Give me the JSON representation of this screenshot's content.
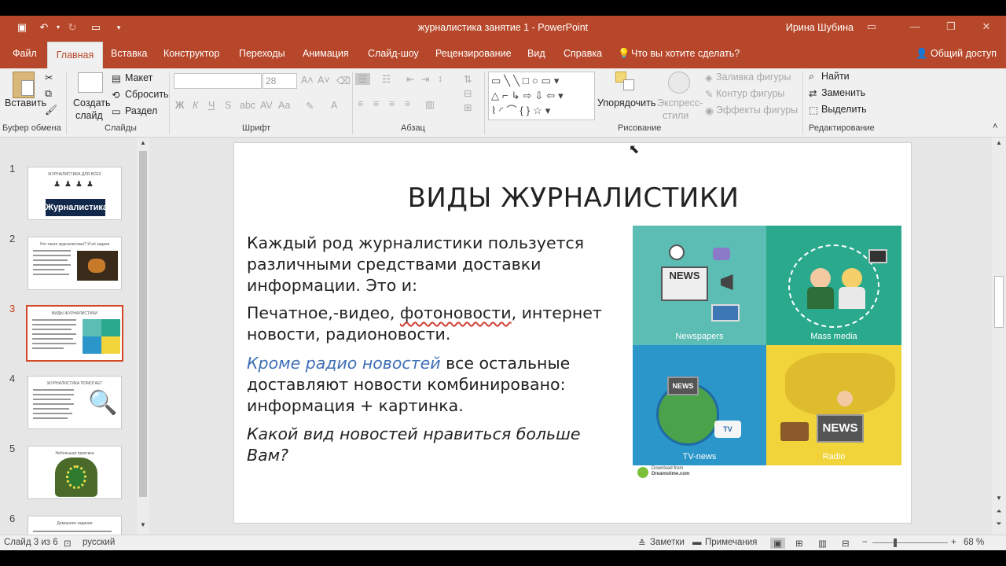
{
  "titlebar": {
    "title": "журналистика занятие 1  -  PowerPoint",
    "user": "Ирина Шубина",
    "bg": "#b7472a"
  },
  "menu": {
    "file": "Файл",
    "home": "Главная",
    "insert": "Вставка",
    "design": "Конструктор",
    "transitions": "Переходы",
    "animation": "Анимация",
    "slideshow": "Слайд-шоу",
    "review": "Рецензирование",
    "view": "Вид",
    "help": "Справка",
    "tellme": "Что вы хотите сделать?",
    "share": "Общий доступ"
  },
  "ribbon": {
    "clipboard": {
      "paste": "Вставить",
      "label": "Буфер обмена"
    },
    "slides": {
      "new_slide_1": "Создать",
      "new_slide_2": "слайд",
      "layout": "Макет",
      "reset": "Сбросить",
      "section": "Раздел",
      "label": "Слайды"
    },
    "font": {
      "size": "28",
      "bold": "Ж",
      "italic": "К",
      "underline": "Ч",
      "strike": "S",
      "label": "Шрифт"
    },
    "paragraph": {
      "label": "Абзац"
    },
    "drawing": {
      "arrange": "Упорядочить",
      "styles_1": "Экспресс-",
      "styles_2": "стили",
      "fill": "Заливка фигуры",
      "outline": "Контур фигуры",
      "effects": "Эффекты фигуры",
      "label": "Рисование"
    },
    "editing": {
      "find": "Найти",
      "replace": "Заменить",
      "select": "Выделить",
      "label": "Редактирование"
    }
  },
  "thumbnails": [
    {
      "num": "1",
      "title": "ЖУРНАЛИСТИКА ДЛЯ ВСЕХ",
      "banner": "Журналистика"
    },
    {
      "num": "2",
      "title": "Что такое журналистика? И её задачи"
    },
    {
      "num": "3",
      "title": "ВИДЫ ЖУРНАЛИСТИКИ"
    },
    {
      "num": "4",
      "title": "ЖУРНАЛИСТИКА ПОМОГАЕТ"
    },
    {
      "num": "5",
      "title": "Небольшая практика"
    },
    {
      "num": "6",
      "title": "Домашнее задание"
    }
  ],
  "slide": {
    "title": "ВИДЫ ЖУРНАЛИСТИКИ",
    "p1": "Каждый род журналистики пользуется различными средствами доставки информации. Это и:",
    "p2_a": "Печатное,-видео, ",
    "p2_b": "фотоновости",
    "p2_c": ", интернет новости, радионовости.",
    "p3_a": "Кроме радио новостей",
    "p3_b": " все остальные доставляют новости комбинировано: информация + картинка.",
    "p4": "Какой вид новостей нравиться больше Вам?",
    "image": {
      "q1": "Newspapers",
      "q2": "Mass media",
      "q3": "TV-news",
      "q4": "Radio",
      "colors": {
        "q1": "#5bbdb4",
        "q2": "#2aa98d",
        "q3": "#2b96c9",
        "q4": "#f0d43a"
      },
      "footer": "Download from",
      "footer2": "Dreamstime.com"
    }
  },
  "status": {
    "slide": "Слайд 3 из 6",
    "lang": "русский",
    "notes": "Заметки",
    "comments": "Примечания",
    "zoom": "68 %"
  }
}
